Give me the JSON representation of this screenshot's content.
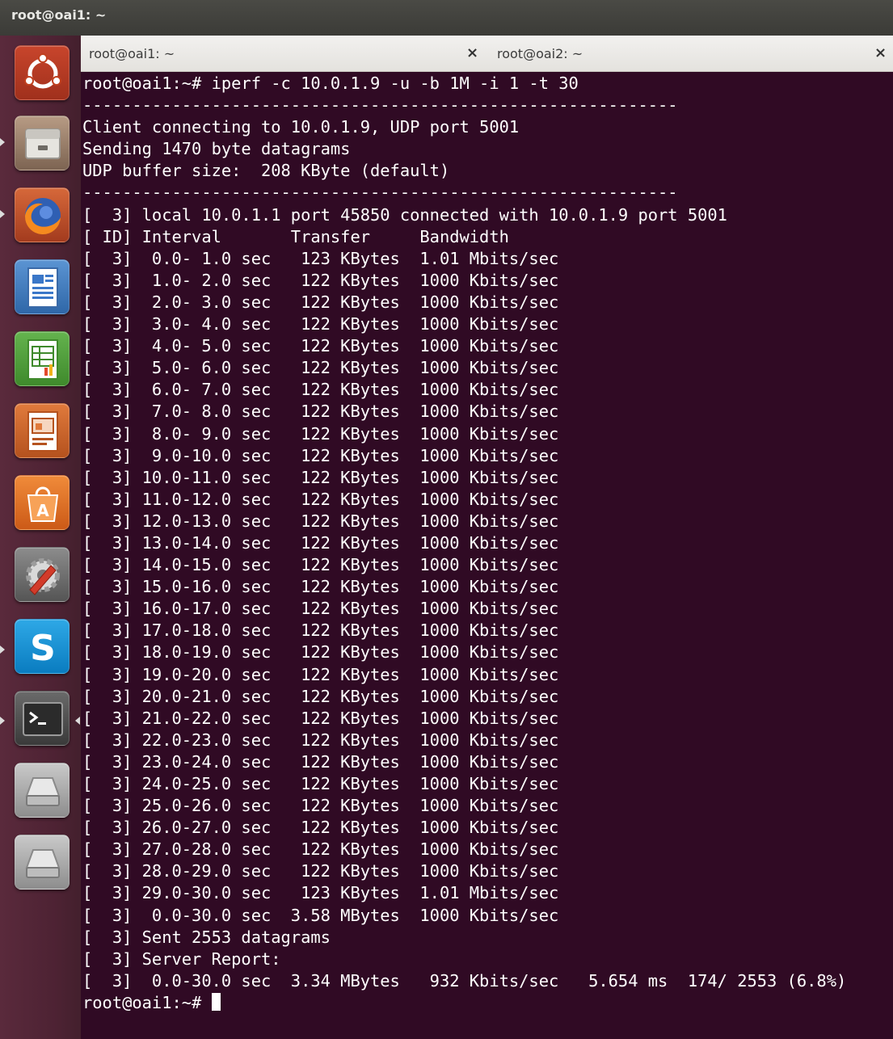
{
  "panel": {
    "title": "root@oai1: ~"
  },
  "tabs": [
    {
      "label": "root@oai1: ~",
      "close": "×"
    },
    {
      "label": "root@oai2: ~",
      "close": "×"
    }
  ],
  "launcher": {
    "items": [
      {
        "icon": "dash-home-icon"
      },
      {
        "icon": "files-icon"
      },
      {
        "icon": "firefox-icon"
      },
      {
        "icon": "writer-icon"
      },
      {
        "icon": "calc-icon"
      },
      {
        "icon": "impress-icon"
      },
      {
        "icon": "software-center-icon"
      },
      {
        "icon": "system-settings-icon"
      },
      {
        "icon": "skype-icon"
      },
      {
        "icon": "terminal-icon"
      },
      {
        "icon": "drive-icon"
      },
      {
        "icon": "drive-icon"
      }
    ]
  },
  "colors": {
    "terminal_bg": "#300a24",
    "terminal_fg": "#ffffff",
    "launcher_bg": "#4d2233",
    "panel_bg": "#3b3b37"
  },
  "terminal": {
    "lines": [
      "root@oai1:~# iperf -c 10.0.1.9 -u -b 1M -i 1 -t 30",
      "------------------------------------------------------------",
      "Client connecting to 10.0.1.9, UDP port 5001",
      "Sending 1470 byte datagrams",
      "UDP buffer size:  208 KByte (default)",
      "------------------------------------------------------------",
      "[  3] local 10.0.1.1 port 45850 connected with 10.0.1.9 port 5001",
      "[ ID] Interval       Transfer     Bandwidth",
      "[  3]  0.0- 1.0 sec   123 KBytes  1.01 Mbits/sec",
      "[  3]  1.0- 2.0 sec   122 KBytes  1000 Kbits/sec",
      "[  3]  2.0- 3.0 sec   122 KBytes  1000 Kbits/sec",
      "[  3]  3.0- 4.0 sec   122 KBytes  1000 Kbits/sec",
      "[  3]  4.0- 5.0 sec   122 KBytes  1000 Kbits/sec",
      "[  3]  5.0- 6.0 sec   122 KBytes  1000 Kbits/sec",
      "[  3]  6.0- 7.0 sec   122 KBytes  1000 Kbits/sec",
      "[  3]  7.0- 8.0 sec   122 KBytes  1000 Kbits/sec",
      "[  3]  8.0- 9.0 sec   122 KBytes  1000 Kbits/sec",
      "[  3]  9.0-10.0 sec   122 KBytes  1000 Kbits/sec",
      "[  3] 10.0-11.0 sec   122 KBytes  1000 Kbits/sec",
      "[  3] 11.0-12.0 sec   122 KBytes  1000 Kbits/sec",
      "[  3] 12.0-13.0 sec   122 KBytes  1000 Kbits/sec",
      "[  3] 13.0-14.0 sec   122 KBytes  1000 Kbits/sec",
      "[  3] 14.0-15.0 sec   122 KBytes  1000 Kbits/sec",
      "[  3] 15.0-16.0 sec   122 KBytes  1000 Kbits/sec",
      "[  3] 16.0-17.0 sec   122 KBytes  1000 Kbits/sec",
      "[  3] 17.0-18.0 sec   122 KBytes  1000 Kbits/sec",
      "[  3] 18.0-19.0 sec   122 KBytes  1000 Kbits/sec",
      "[  3] 19.0-20.0 sec   122 KBytes  1000 Kbits/sec",
      "[  3] 20.0-21.0 sec   122 KBytes  1000 Kbits/sec",
      "[  3] 21.0-22.0 sec   122 KBytes  1000 Kbits/sec",
      "[  3] 22.0-23.0 sec   122 KBytes  1000 Kbits/sec",
      "[  3] 23.0-24.0 sec   122 KBytes  1000 Kbits/sec",
      "[  3] 24.0-25.0 sec   122 KBytes  1000 Kbits/sec",
      "[  3] 25.0-26.0 sec   122 KBytes  1000 Kbits/sec",
      "[  3] 26.0-27.0 sec   122 KBytes  1000 Kbits/sec",
      "[  3] 27.0-28.0 sec   122 KBytes  1000 Kbits/sec",
      "[  3] 28.0-29.0 sec   122 KBytes  1000 Kbits/sec",
      "[  3] 29.0-30.0 sec   123 KBytes  1.01 Mbits/sec",
      "[  3]  0.0-30.0 sec  3.58 MBytes  1000 Kbits/sec",
      "[  3] Sent 2553 datagrams",
      "[  3] Server Report:",
      "[  3]  0.0-30.0 sec  3.34 MBytes   932 Kbits/sec   5.654 ms  174/ 2553 (6.8%)"
    ],
    "prompt": "root@oai1:~# "
  }
}
